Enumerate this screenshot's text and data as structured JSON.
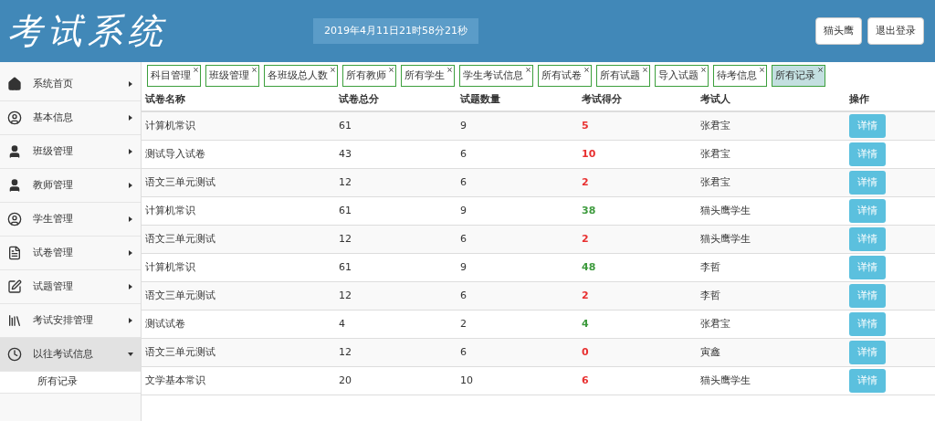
{
  "header": {
    "title": "考试系统",
    "datetime": "2019年4月11日21时58分21秒",
    "buttons": [
      "猫头鹰",
      "退出登录"
    ]
  },
  "sidebar": {
    "items": [
      {
        "label": "系统首页",
        "expanded": false
      },
      {
        "label": "基本信息",
        "expanded": false
      },
      {
        "label": "班级管理",
        "expanded": false
      },
      {
        "label": "教师管理",
        "expanded": false
      },
      {
        "label": "学生管理",
        "expanded": false
      },
      {
        "label": "试卷管理",
        "expanded": false
      },
      {
        "label": "试题管理",
        "expanded": false
      },
      {
        "label": "考试安排管理",
        "expanded": false
      },
      {
        "label": "以往考试信息",
        "expanded": true,
        "children": [
          {
            "label": "所有记录"
          }
        ]
      }
    ]
  },
  "tabs": [
    {
      "label": "科目管理",
      "selected": false
    },
    {
      "label": "班级管理",
      "selected": false
    },
    {
      "label": "各班级总人数",
      "selected": false
    },
    {
      "label": "所有教师",
      "selected": false
    },
    {
      "label": "所有学生",
      "selected": false
    },
    {
      "label": "学生考试信息",
      "selected": false
    },
    {
      "label": "所有试卷",
      "selected": false
    },
    {
      "label": "所有试题",
      "selected": false
    },
    {
      "label": "导入试题",
      "selected": false
    },
    {
      "label": "待考信息",
      "selected": false
    },
    {
      "label": "所有记录",
      "selected": true
    }
  ],
  "table": {
    "columns": [
      "试卷名称",
      "试卷总分",
      "试题数量",
      "考试得分",
      "考试人",
      "操作"
    ],
    "rows": [
      {
        "name": "计算机常识",
        "total": "61",
        "count": "9",
        "score": "5",
        "passed": false,
        "person": "张君宝",
        "action": "详情"
      },
      {
        "name": "测试导入试卷",
        "total": "43",
        "count": "6",
        "score": "10",
        "passed": false,
        "person": "张君宝",
        "action": "详情"
      },
      {
        "name": "语文三单元测试",
        "total": "12",
        "count": "6",
        "score": "2",
        "passed": false,
        "person": "张君宝",
        "action": "详情"
      },
      {
        "name": "计算机常识",
        "total": "61",
        "count": "9",
        "score": "38",
        "passed": true,
        "person": "猫头鹰学生",
        "action": "详情"
      },
      {
        "name": "语文三单元测试",
        "total": "12",
        "count": "6",
        "score": "2",
        "passed": false,
        "person": "猫头鹰学生",
        "action": "详情"
      },
      {
        "name": "计算机常识",
        "total": "61",
        "count": "9",
        "score": "48",
        "passed": true,
        "person": "李哲",
        "action": "详情"
      },
      {
        "name": "语文三单元测试",
        "total": "12",
        "count": "6",
        "score": "2",
        "passed": false,
        "person": "李哲",
        "action": "详情"
      },
      {
        "name": "测试试卷",
        "total": "4",
        "count": "2",
        "score": "4",
        "passed": true,
        "person": "张君宝",
        "action": "详情"
      },
      {
        "name": "语文三单元测试",
        "total": "12",
        "count": "6",
        "score": "0",
        "passed": false,
        "person": "寅鑫",
        "action": "详情"
      },
      {
        "name": "文学基本常识",
        "total": "20",
        "count": "10",
        "score": "6",
        "passed": false,
        "person": "猫头鹰学生",
        "action": "详情"
      }
    ]
  }
}
